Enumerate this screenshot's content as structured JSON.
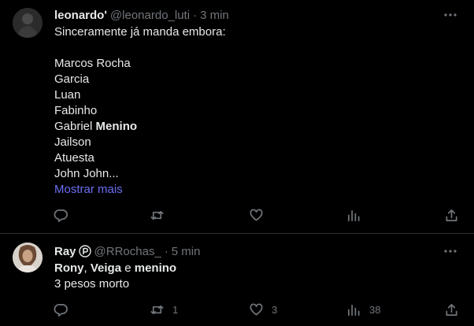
{
  "tweets": [
    {
      "display_name": "leonardoʹ",
      "handle": "@leonardo_luti",
      "separator": "·",
      "time": "3 min",
      "lines": [
        "Sinceramente já manda embora:",
        "",
        "Marcos Rocha",
        "Garcia",
        "Luan",
        "Fabinho",
        [
          "Gabriel ",
          "Menino"
        ],
        "Jailson",
        "Atuesta",
        "John John..."
      ],
      "show_more": "Mostrar mais",
      "actions": {
        "replies": "",
        "retweets": "",
        "likes": "",
        "views": ""
      }
    },
    {
      "display_name": "Ray",
      "handle": "@RRochas_",
      "separator": "·",
      "time": "5 min",
      "line1": {
        "a": "Rony",
        "sep1": ", ",
        "b": "Veiga",
        "sep2": " e ",
        "c": "menino"
      },
      "line2": "3 pesos morto",
      "actions": {
        "replies": "",
        "retweets": "1",
        "likes": "3",
        "views": "38"
      }
    }
  ],
  "colors": {
    "background": "#000000",
    "text": "#e7e9ea",
    "secondary": "#71767b",
    "link": "#6c6ff2",
    "divider": "#2f3336"
  },
  "icons": [
    "more-icon",
    "reply-icon",
    "retweet-icon",
    "like-icon",
    "views-icon",
    "share-icon",
    "verified-p-icon"
  ]
}
